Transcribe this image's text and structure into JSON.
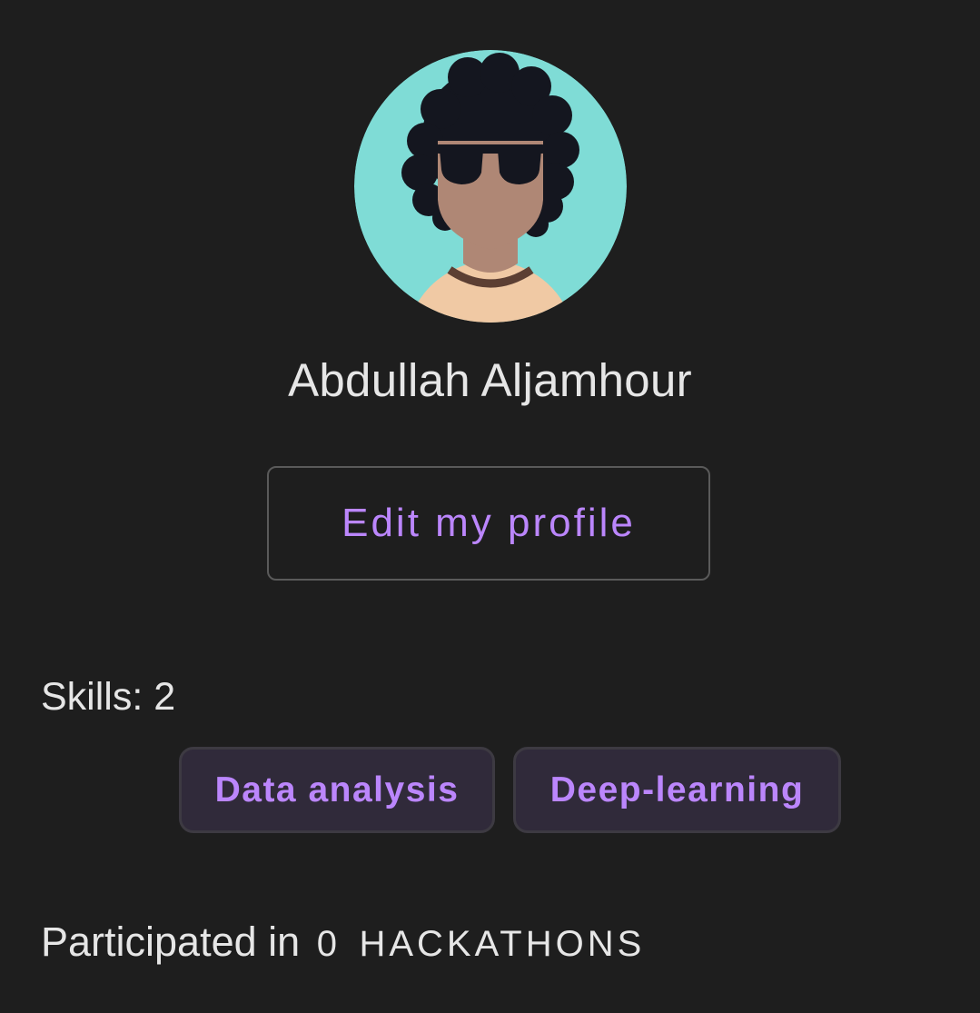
{
  "profile": {
    "avatar_icon": "user-avatar-illustration",
    "name": "Abdullah Aljamhour",
    "edit_button_label": "Edit my profile"
  },
  "skills": {
    "label": "Skills: 2",
    "items": [
      {
        "label": "Data analysis"
      },
      {
        "label": "Deep-learning"
      }
    ]
  },
  "participation": {
    "prefix": "Participated in",
    "count": "0",
    "unit": "HACKATHONS"
  },
  "colors": {
    "background": "#1e1e1e",
    "accent": "#bb86fc",
    "text_primary": "#e6e6e6",
    "chip_background": "#302a3a",
    "avatar_background": "#7fdcd6"
  }
}
